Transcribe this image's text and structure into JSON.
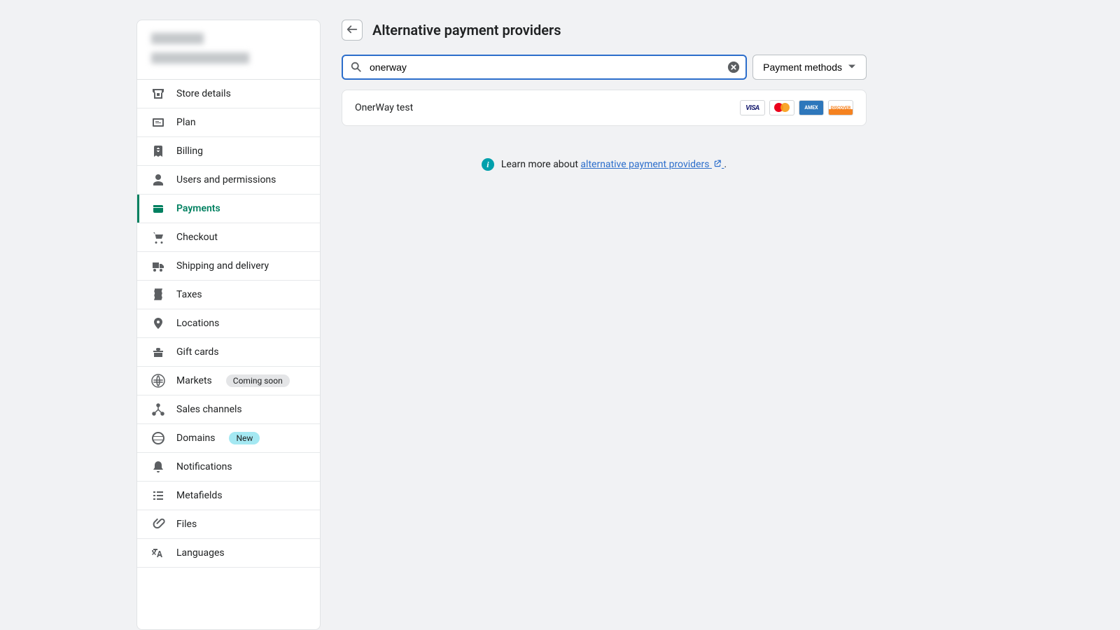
{
  "header": {
    "title": "Alternative payment providers"
  },
  "search": {
    "value": "onerway",
    "filter_label": "Payment methods"
  },
  "result": {
    "title": "OnerWay test",
    "cards": [
      "visa",
      "mastercard",
      "amex",
      "discover"
    ]
  },
  "learn_more": {
    "prefix": "Learn more about ",
    "link_text": "alternative payment providers",
    "suffix": " ."
  },
  "sidebar": {
    "items": [
      {
        "label": "Store details",
        "icon": "store"
      },
      {
        "label": "Plan",
        "icon": "plan"
      },
      {
        "label": "Billing",
        "icon": "billing"
      },
      {
        "label": "Users and permissions",
        "icon": "users"
      },
      {
        "label": "Payments",
        "icon": "payments",
        "active": true
      },
      {
        "label": "Checkout",
        "icon": "checkout"
      },
      {
        "label": "Shipping and delivery",
        "icon": "shipping"
      },
      {
        "label": "Taxes",
        "icon": "taxes"
      },
      {
        "label": "Locations",
        "icon": "locations"
      },
      {
        "label": "Gift cards",
        "icon": "gift"
      },
      {
        "label": "Markets",
        "icon": "markets",
        "badge": "Coming soon",
        "badge_type": "default"
      },
      {
        "label": "Sales channels",
        "icon": "channels"
      },
      {
        "label": "Domains",
        "icon": "domains",
        "badge": "New",
        "badge_type": "new"
      },
      {
        "label": "Notifications",
        "icon": "notifications"
      },
      {
        "label": "Metafields",
        "icon": "metafields"
      },
      {
        "label": "Files",
        "icon": "files"
      },
      {
        "label": "Languages",
        "icon": "languages"
      }
    ]
  }
}
